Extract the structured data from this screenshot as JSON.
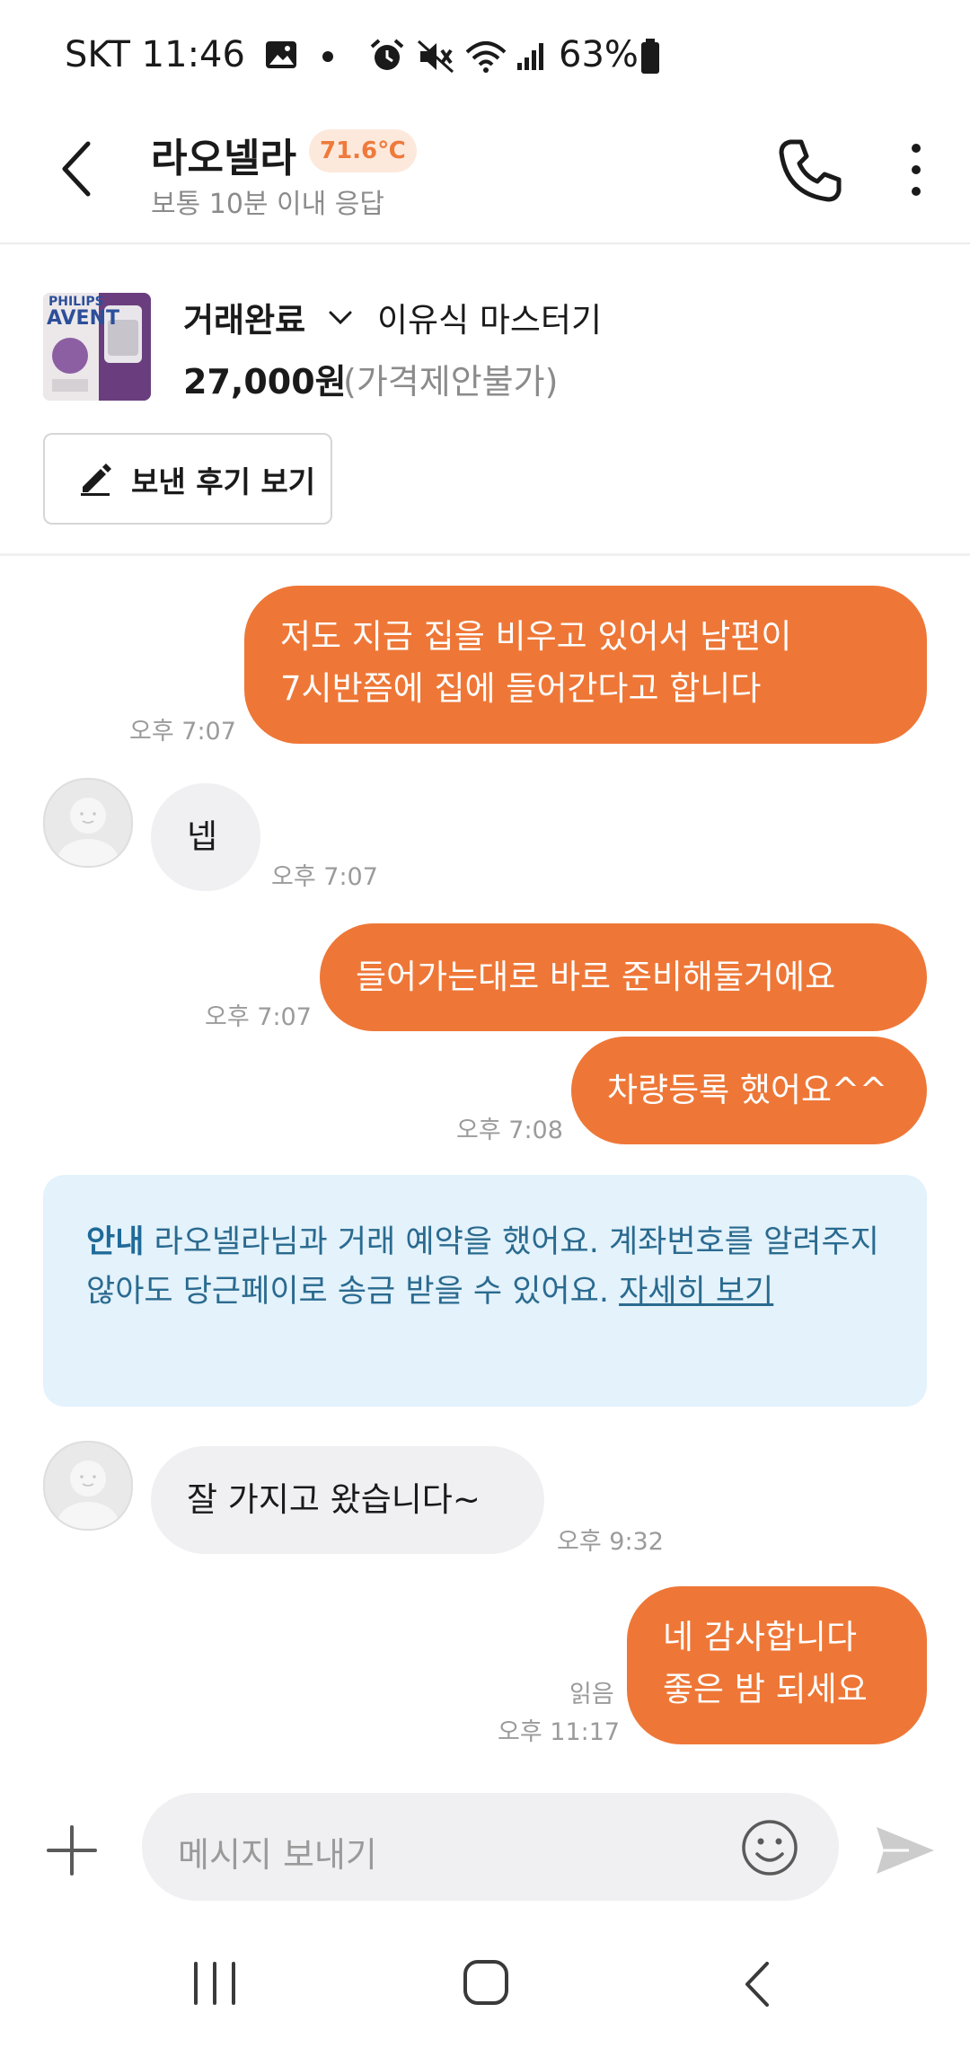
{
  "status_bar": {
    "carrier_time": "SKT 11:46",
    "battery": "63%",
    "icons": [
      "gallery-icon",
      "dot-icon",
      "alarm-icon",
      "mute-icon",
      "wifi-icon",
      "signal-icon",
      "battery-icon"
    ]
  },
  "header": {
    "name": "라오넬라",
    "temperature": "71.6℃",
    "response": "보통 10분 이내 응답"
  },
  "product": {
    "status": "거래완료",
    "name": "이유식 마스터기",
    "price": "27,000원",
    "price_note": "(가격제안불가)",
    "thumb_brand": "PHILIPS",
    "thumb_logo": "AVENT",
    "review_button": "보낸 후기 보기"
  },
  "messages": {
    "m1": {
      "line1": "저도 지금 집을 비우고 있어서 남편이",
      "line2": "7시반쯤에 집에 들어간다고 합니다",
      "time": "오후 7:07"
    },
    "m2": {
      "text": "넵",
      "time": "오후 7:07"
    },
    "m3": {
      "text": "들어가는대로 바로 준비해둘거에요",
      "time": "오후 7:07"
    },
    "m4": {
      "text": "차량등록 했어요^^",
      "time": "오후 7:08"
    },
    "m5": {
      "text": "잘 가지고 왔습니다~",
      "time": "오후 9:32"
    },
    "m6": {
      "line1": "네 감사합니다",
      "line2": "좋은 밤 되세요",
      "read": "읽음",
      "time": "오후 11:17"
    }
  },
  "notice": {
    "label": "안내",
    "text": " 라오넬라님과 거래 예약을 했어요. 계좌번호를 알려주지 않아도 당근페이로 송금 받을 수 있어요. ",
    "link": "자세히 보기"
  },
  "input": {
    "placeholder": "메시지 보내기"
  },
  "colors": {
    "accent": "#ee7737",
    "notice_bg": "#e3f2fb",
    "notice_text": "#2a6a8f",
    "in_bubble": "#f0f0f2"
  }
}
